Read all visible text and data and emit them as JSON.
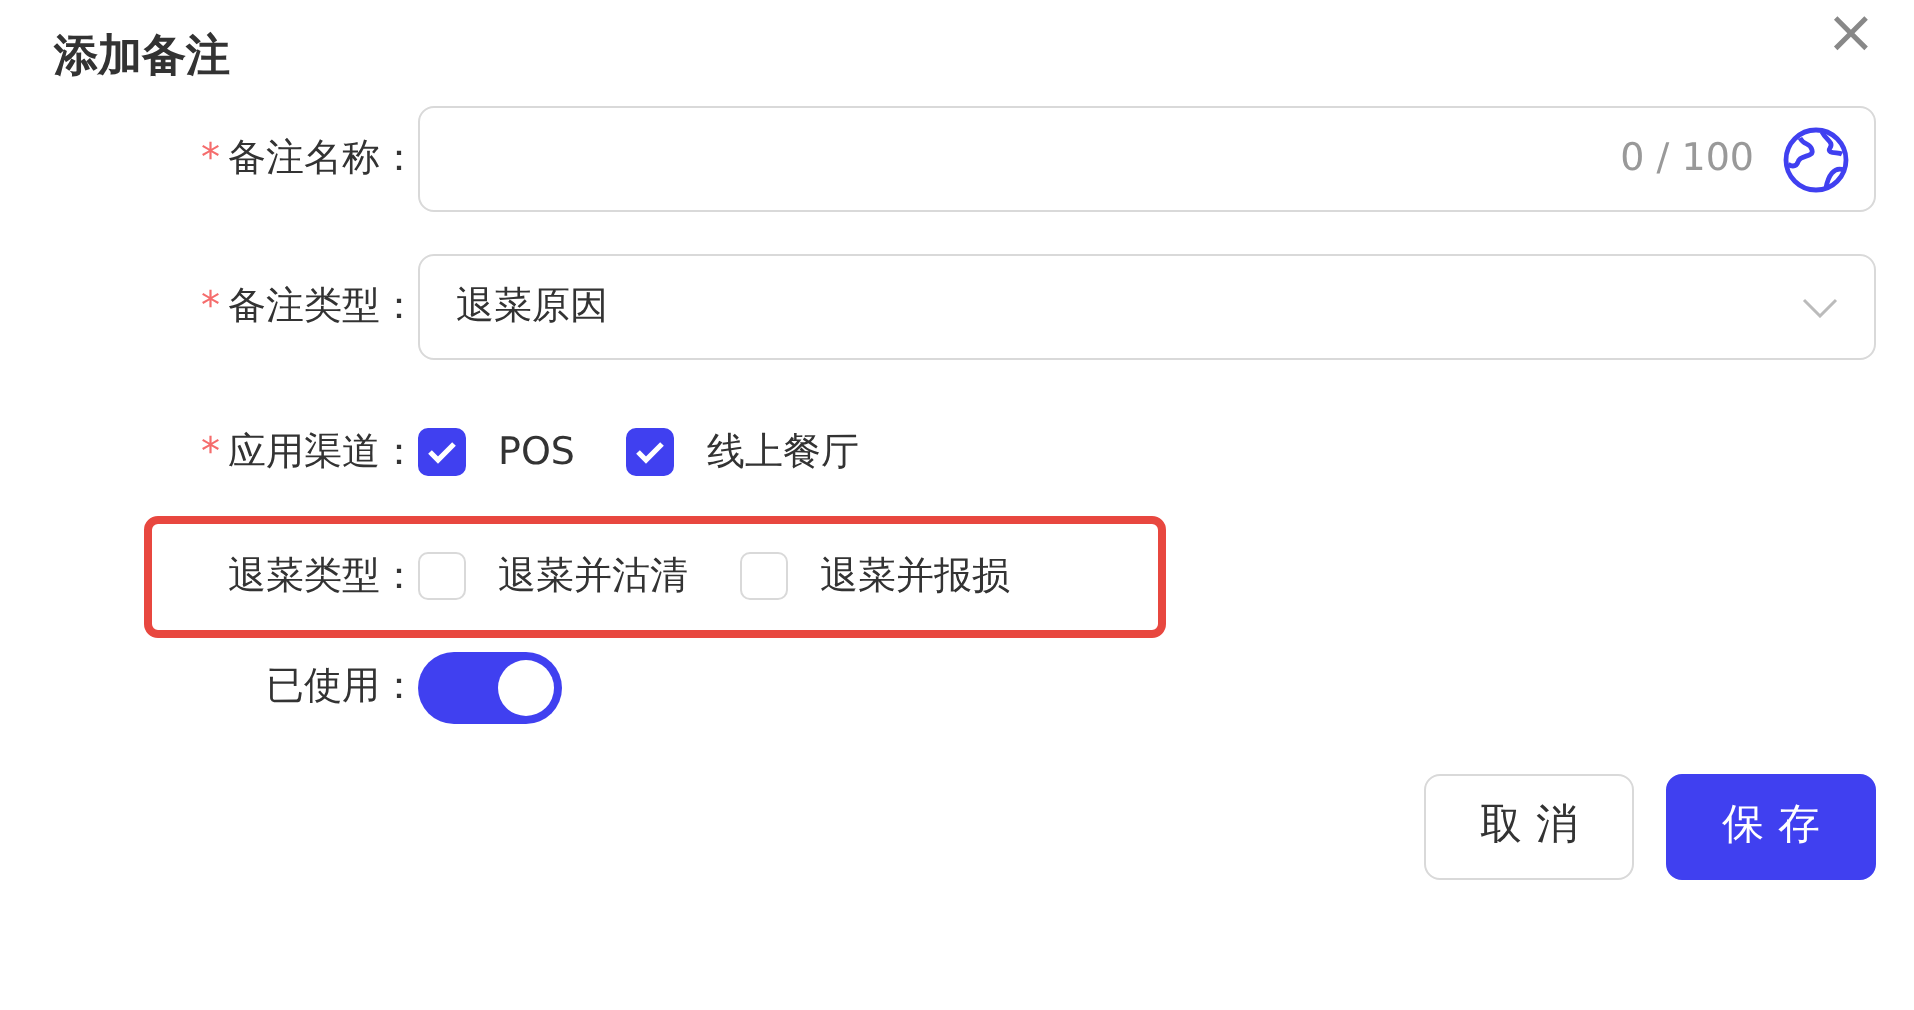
{
  "dialog": {
    "title": "添加备注",
    "close": "×"
  },
  "fields": [
    {
      "kind": "text",
      "required_mark": "*",
      "label": "备注名称：",
      "counter": "0 / 100"
    },
    {
      "kind": "select",
      "required_mark": "*",
      "label": "备注类型：",
      "value": "退菜原因"
    },
    {
      "kind": "checks",
      "required_mark": "*",
      "label": "应用渠道：",
      "highlighted": false,
      "options": [
        {
          "label": "POS",
          "checked": true
        },
        {
          "label": "线上餐厅",
          "checked": true
        }
      ]
    },
    {
      "kind": "checks",
      "label": "退菜类型：",
      "highlighted": true,
      "options": [
        {
          "label": "退菜并沽清",
          "checked": false
        },
        {
          "label": "退菜并报损",
          "checked": false
        }
      ]
    },
    {
      "kind": "switch",
      "label": "已使用：",
      "on": true
    }
  ],
  "buttons": [
    {
      "label": "取 消",
      "primary": false
    },
    {
      "label": "保 存",
      "primary": true
    }
  ]
}
